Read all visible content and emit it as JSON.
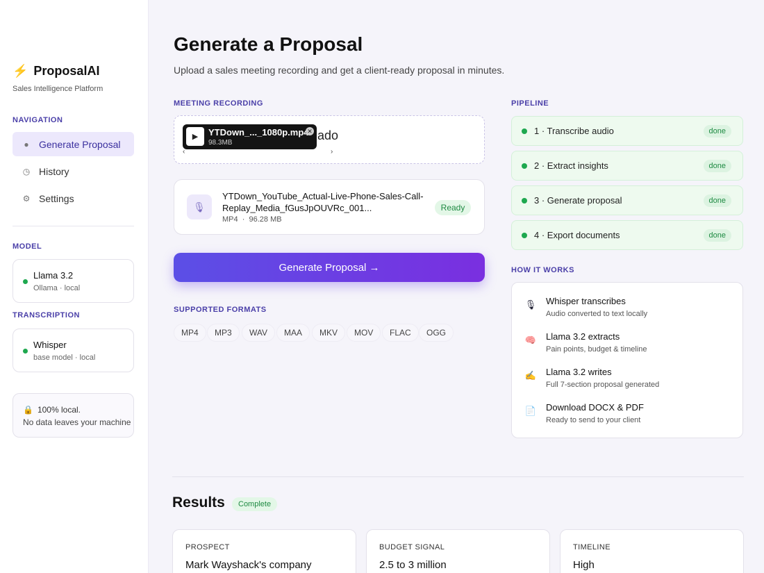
{
  "app": {
    "name": "ProposalAI",
    "tagline": "Sales Intelligence Platform"
  },
  "sidebar": {
    "nav_label": "NAVIGATION",
    "items": [
      {
        "label": "Generate Proposal",
        "icon": "mic-icon",
        "active": true
      },
      {
        "label": "History",
        "icon": "history-icon",
        "active": false
      },
      {
        "label": "Settings",
        "icon": "gear-icon",
        "active": false
      }
    ],
    "model_label": "MODEL",
    "model": {
      "name": "Llama 3.2",
      "detail": "Ollama · local"
    },
    "transcription_label": "TRANSCRIPTION",
    "transcription": {
      "name": "Whisper",
      "detail": "base model · local"
    },
    "privacy": {
      "line1": "100% local.",
      "line2": "No data leaves your machine",
      "icon": "lock-icon"
    }
  },
  "main": {
    "title": "Generate a Proposal",
    "subtitle": "Upload a sales meeting recording and get a client-ready proposal in minutes.",
    "recording_label": "MEETING RECORDING",
    "dropzone": {
      "chip_name": "YTDown_..._1080p.mp4",
      "chip_size": "98.3MB",
      "partial_text": "ado",
      "left_arrow": "‹",
      "right_arrow": "›"
    },
    "file": {
      "name": "YTDown_YouTube_Actual-Live-Phone-Sales-Call-Replay_Media_fGusJpOUVRc_001...",
      "type": "MP4",
      "size": "96.28 MB",
      "status": "Ready"
    },
    "generate_button": "Generate Proposal →",
    "formats_label": "SUPPORTED FORMATS",
    "formats": [
      "MP4",
      "MP3",
      "WAV",
      "MAA",
      "MKV",
      "MOV",
      "FLAC",
      "OGG"
    ]
  },
  "pipeline": {
    "label": "PIPELINE",
    "steps": [
      {
        "label": "1 · Transcribe audio",
        "status": "done"
      },
      {
        "label": "2 · Extract insights",
        "status": "done"
      },
      {
        "label": "3 · Generate proposal",
        "status": "done"
      },
      {
        "label": "4 · Export documents",
        "status": "done"
      }
    ]
  },
  "how_it_works": {
    "label": "HOW IT WORKS",
    "items": [
      {
        "title": "Whisper transcribes",
        "subtitle": "Audio converted to text locally",
        "icon": "mic-icon"
      },
      {
        "title": "Llama 3.2 extracts",
        "subtitle": "Pain points, budget & timeline",
        "icon": "brain-icon"
      },
      {
        "title": "Llama 3.2 writes",
        "subtitle": "Full 7-section proposal generated",
        "icon": "writing-hand-icon"
      },
      {
        "title": "Download DOCX & PDF",
        "subtitle": "Ready to send to your client",
        "icon": "document-icon"
      }
    ]
  },
  "results": {
    "title": "Results",
    "status": "Complete",
    "cards": [
      {
        "label": "PROSPECT",
        "value": "Mark Wayshack's company"
      },
      {
        "label": "BUDGET SIGNAL",
        "value": "2.5 to 3 million"
      },
      {
        "label": "TIMELINE",
        "value": "High"
      }
    ]
  },
  "colors": {
    "accent": "#5b4fe6",
    "accent_end": "#7a2fe0",
    "success": "#1ea84f",
    "section_label": "#4a3fa8"
  }
}
